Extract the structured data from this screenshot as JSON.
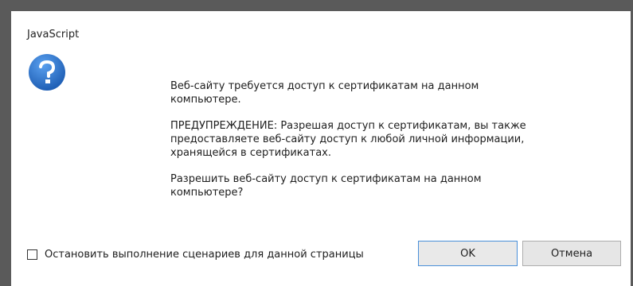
{
  "dialog": {
    "title": "JavaScript",
    "icon": "question-mark-icon",
    "message_lines": [
      "Веб-сайту требуется доступ к сертификатам на данном компьютере.",
      "ПРЕДУПРЕЖДЕНИЕ: Разрешая доступ к сертификатам, вы также предоставляете веб-сайту доступ к любой личной информации, хранящейся в сертификатах.",
      "Разрешить веб-сайту доступ к сертификатам на данном компьютере?"
    ],
    "checkbox": {
      "label": "Остановить выполнение сценариев для данной страницы",
      "checked": false
    },
    "buttons": {
      "ok_label": "OK",
      "cancel_label": "Отмена"
    }
  },
  "colors": {
    "icon_blue": "#2f73c9",
    "focus_border": "#4a90d9"
  }
}
